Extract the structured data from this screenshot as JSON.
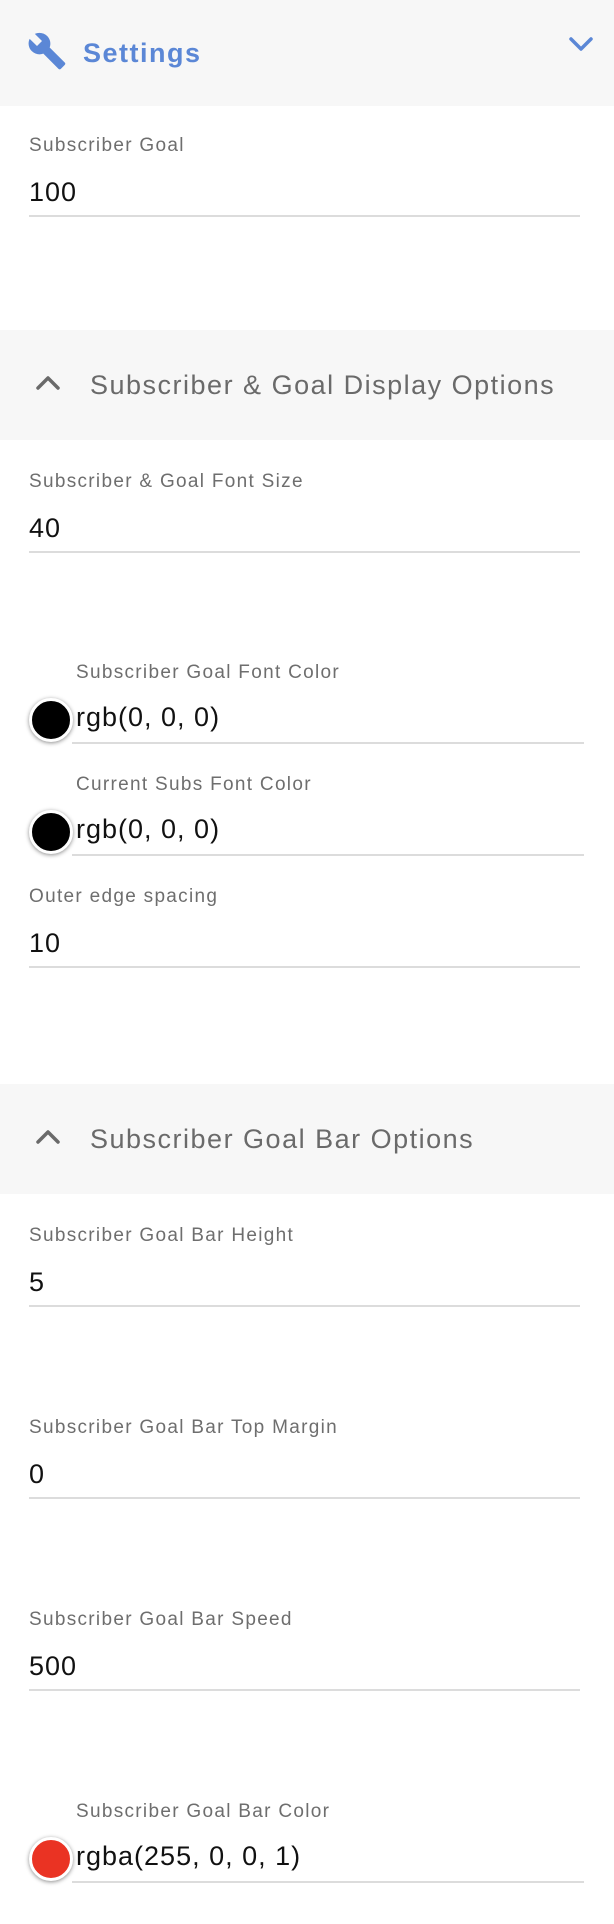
{
  "header": {
    "title": "Settings"
  },
  "fields": {
    "subscriber_goal": {
      "label": "Subscriber Goal",
      "value": "100"
    },
    "font_size": {
      "label": "Subscriber & Goal Font Size",
      "value": "40"
    },
    "outer_edge_spacing": {
      "label": "Outer edge spacing",
      "value": "10"
    },
    "bar_height": {
      "label": "Subscriber Goal Bar Height",
      "value": "5"
    },
    "bar_top_margin": {
      "label": "Subscriber Goal Bar Top Margin",
      "value": "0"
    },
    "bar_speed": {
      "label": "Subscriber Goal Bar Speed",
      "value": "500"
    }
  },
  "sections": {
    "display_options": {
      "title": "Subscriber & Goal Display Options"
    },
    "bar_options": {
      "title": "Subscriber Goal Bar Options"
    }
  },
  "colors": {
    "goal_font": {
      "label": "Subscriber Goal Font Color",
      "value": "rgb(0, 0, 0)",
      "swatch": "#000000"
    },
    "current_subs_font": {
      "label": "Current Subs Font Color",
      "value": "rgb(0, 0, 0)",
      "swatch": "#000000"
    },
    "bar_color": {
      "label": "Subscriber Goal Bar Color",
      "value": "rgba(255, 0, 0, 1)",
      "swatch": "#ea3323"
    }
  },
  "icons": {
    "settings": "wrench-icon",
    "collapse": "chevron-down-icon",
    "expand": "chevron-up-icon"
  },
  "theme": {
    "accent": "#5b87d6",
    "header_bg": "#f7f7f7"
  }
}
